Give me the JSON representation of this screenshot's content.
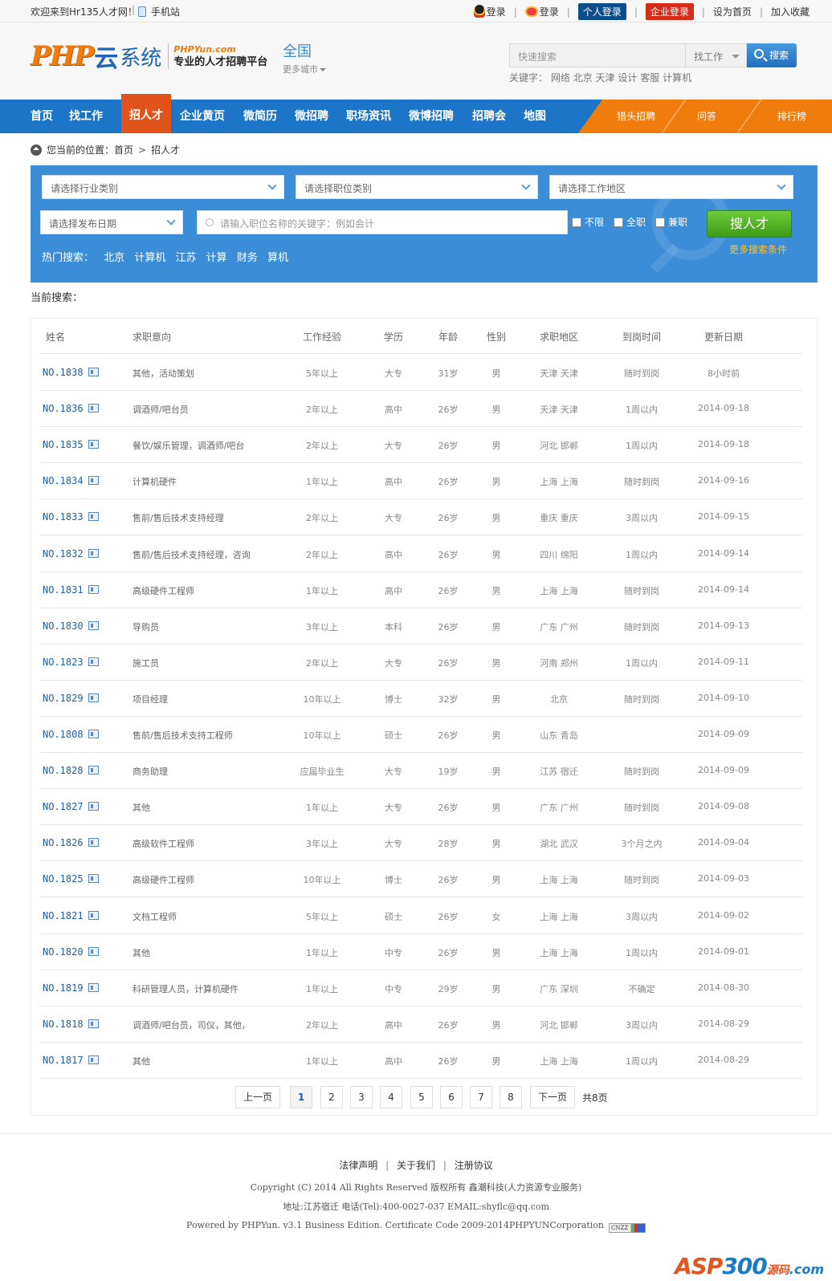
{
  "topbar": {
    "welcome": "欢迎来到Hr135人才网！",
    "mobile": "手机站",
    "qq_login": "登录",
    "weibo_login": "登录",
    "personal_login": "个人登录",
    "company_login": "企业登录",
    "set_home": "设为首页",
    "favorite": "加入收藏"
  },
  "header": {
    "logo_php": "PHP",
    "logo_yun": "云",
    "logo_xitong": "系统",
    "logo_site": "PHPYun.com",
    "logo_slogan": "专业的人才招聘平台",
    "city_current": "全国",
    "city_more": "更多城市",
    "search_placeholder": "快速搜索",
    "search_type": "找工作",
    "search_button": "搜索",
    "keywords_label": "关键字：",
    "keywords": [
      "网络",
      "北京",
      "天津",
      "设计",
      "客服",
      "计算机"
    ]
  },
  "nav": {
    "items": [
      "首页",
      "找工作",
      "招人才",
      "企业黄页",
      "微简历",
      "微招聘",
      "职场资讯",
      "微博招聘",
      "招聘会",
      "地图"
    ],
    "active_index": 2,
    "right_items": [
      "猎头招聘",
      "问答",
      "排行榜"
    ]
  },
  "breadcrumb": {
    "label": "您当前的位置：",
    "home": "首页",
    "current": "招人才"
  },
  "search_panel": {
    "industry": "请选择行业类别",
    "job_category": "请选择职位类别",
    "area": "请选择工作地区",
    "date": "请选择发布日期",
    "keyword_placeholder": "请输入职位名称的关键字：例如会计",
    "checkboxes": [
      "不限",
      "全职",
      "兼职"
    ],
    "search_button": "搜人才",
    "more_conditions": "更多搜索条件",
    "hot_label": "热门搜索：",
    "hot_items": [
      "北京",
      "计算机",
      "江苏",
      "计算",
      "财务",
      "算机"
    ]
  },
  "current_search_label": "当前搜索：",
  "table": {
    "headers": [
      "姓名",
      "求职意向",
      "工作经验",
      "学历",
      "年龄",
      "性别",
      "求职地区",
      "到岗时间",
      "更新日期"
    ],
    "rows": [
      {
        "id": "NO.1838",
        "job": "其他，活动策划",
        "exp": "5年以上",
        "edu": "大专",
        "age": "31岁",
        "sex": "男",
        "region": "天津 天津",
        "arrive": "随时到岗",
        "updated": "8小时前"
      },
      {
        "id": "NO.1836",
        "job": "调酒师/吧台员",
        "exp": "2年以上",
        "edu": "高中",
        "age": "26岁",
        "sex": "男",
        "region": "天津 天津",
        "arrive": "1周以内",
        "updated": "2014-09-18"
      },
      {
        "id": "NO.1835",
        "job": "餐饮/娱乐管理，调酒师/吧台",
        "exp": "2年以上",
        "edu": "大专",
        "age": "26岁",
        "sex": "男",
        "region": "河北 邯郸",
        "arrive": "1周以内",
        "updated": "2014-09-18"
      },
      {
        "id": "NO.1834",
        "job": "计算机硬件",
        "exp": "1年以上",
        "edu": "高中",
        "age": "26岁",
        "sex": "男",
        "region": "上海 上海",
        "arrive": "随时到岗",
        "updated": "2014-09-16"
      },
      {
        "id": "NO.1833",
        "job": "售前/售后技术支持经理",
        "exp": "2年以上",
        "edu": "大专",
        "age": "26岁",
        "sex": "男",
        "region": "重庆 重庆",
        "arrive": "3周以内",
        "updated": "2014-09-15"
      },
      {
        "id": "NO.1832",
        "job": "售前/售后技术支持经理，咨询",
        "exp": "2年以上",
        "edu": "高中",
        "age": "26岁",
        "sex": "男",
        "region": "四川 绵阳",
        "arrive": "1周以内",
        "updated": "2014-09-14"
      },
      {
        "id": "NO.1831",
        "job": "高级硬件工程师",
        "exp": "1年以上",
        "edu": "高中",
        "age": "26岁",
        "sex": "男",
        "region": "上海 上海",
        "arrive": "随时到岗",
        "updated": "2014-09-14"
      },
      {
        "id": "NO.1830",
        "job": "导购员",
        "exp": "3年以上",
        "edu": "本科",
        "age": "26岁",
        "sex": "男",
        "region": "广东 广州",
        "arrive": "随时到岗",
        "updated": "2014-09-13"
      },
      {
        "id": "NO.1823",
        "job": "施工员",
        "exp": "2年以上",
        "edu": "大专",
        "age": "26岁",
        "sex": "男",
        "region": "河南 郑州",
        "arrive": "1周以内",
        "updated": "2014-09-11"
      },
      {
        "id": "NO.1829",
        "job": "项目经理",
        "exp": "10年以上",
        "edu": "博士",
        "age": "32岁",
        "sex": "男",
        "region": "北京",
        "arrive": "随时到岗",
        "updated": "2014-09-10"
      },
      {
        "id": "NO.1808",
        "job": "售前/售后技术支持工程师",
        "exp": "10年以上",
        "edu": "硕士",
        "age": "26岁",
        "sex": "男",
        "region": "山东 青岛",
        "arrive": "",
        "updated": "2014-09-09"
      },
      {
        "id": "NO.1828",
        "job": "商务助理",
        "exp": "应届毕业生",
        "edu": "大专",
        "age": "19岁",
        "sex": "男",
        "region": "江苏 宿迁",
        "arrive": "随时到岗",
        "updated": "2014-09-09"
      },
      {
        "id": "NO.1827",
        "job": "其他",
        "exp": "1年以上",
        "edu": "大专",
        "age": "26岁",
        "sex": "男",
        "region": "广东 广州",
        "arrive": "随时到岗",
        "updated": "2014-09-08"
      },
      {
        "id": "NO.1826",
        "job": "高级软件工程师",
        "exp": "3年以上",
        "edu": "大专",
        "age": "28岁",
        "sex": "男",
        "region": "湖北 武汉",
        "arrive": "3个月之内",
        "updated": "2014-09-04"
      },
      {
        "id": "NO.1825",
        "job": "高级硬件工程师",
        "exp": "10年以上",
        "edu": "博士",
        "age": "26岁",
        "sex": "男",
        "region": "上海 上海",
        "arrive": "随时到岗",
        "updated": "2014-09-03"
      },
      {
        "id": "NO.1821",
        "job": "文档工程师",
        "exp": "5年以上",
        "edu": "硕士",
        "age": "26岁",
        "sex": "女",
        "region": "上海 上海",
        "arrive": "3周以内",
        "updated": "2014-09-02"
      },
      {
        "id": "NO.1820",
        "job": "其他",
        "exp": "1年以上",
        "edu": "中专",
        "age": "26岁",
        "sex": "男",
        "region": "上海 上海",
        "arrive": "1周以内",
        "updated": "2014-09-01"
      },
      {
        "id": "NO.1819",
        "job": "科研管理人员，计算机硬件",
        "exp": "1年以上",
        "edu": "中专",
        "age": "29岁",
        "sex": "男",
        "region": "广东 深圳",
        "arrive": "不确定",
        "updated": "2014-08-30"
      },
      {
        "id": "NO.1818",
        "job": "调酒师/吧台员，司仪，其他，",
        "exp": "2年以上",
        "edu": "高中",
        "age": "26岁",
        "sex": "男",
        "region": "河北 邯郸",
        "arrive": "3周以内",
        "updated": "2014-08-29"
      },
      {
        "id": "NO.1817",
        "job": "其他",
        "exp": "1年以上",
        "edu": "高中",
        "age": "26岁",
        "sex": "男",
        "region": "上海 上海",
        "arrive": "1周以内",
        "updated": "2014-08-29"
      }
    ]
  },
  "pagination": {
    "prev": "上一页",
    "pages": [
      "1",
      "2",
      "3",
      "4",
      "5",
      "6",
      "7",
      "8"
    ],
    "current": "1",
    "next": "下一页",
    "total": "共8页"
  },
  "footer": {
    "links": [
      "法律声明",
      "关于我们",
      "注册协议"
    ],
    "copyright": "Copyright (C) 2014 All Rights Reserved 版权所有 鑫潮科技(人力资源专业服务)",
    "address": "地址:江苏宿迁 电话(Tel):400-0027-037 EMAIL:shyflc@qq.com",
    "powered": "Powered by PHPYun. v3.1 Business Edition. Certificate Code 2009-2014PHPYUNCorporation",
    "cnzz": "CNZZ",
    "watermark_asp": "ASP",
    "watermark_300": "300",
    "watermark_yuanma": "源码",
    "watermark_com": ".com"
  },
  "colors": {
    "nav_blue": "#1c75c6",
    "nav_active": "#e0531a",
    "nav_right_band": "#f07c0c",
    "search_panel": "#3b8dd8",
    "search_button_green": "#4fb022",
    "id_link": "#1d5fa7"
  }
}
